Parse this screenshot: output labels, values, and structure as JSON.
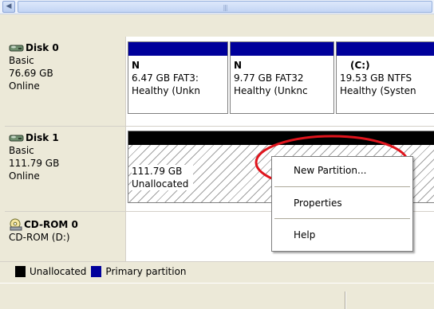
{
  "disks": [
    {
      "name": "Disk 0",
      "type": "Basic",
      "size": "76.69 GB",
      "status": "Online",
      "partitions": [
        {
          "label": "N",
          "detail": "6.47 GB FAT3:",
          "health": "Healthy (Unkn"
        },
        {
          "label": "N",
          "detail": "9.77 GB FAT32",
          "health": "Healthy (Unknc"
        },
        {
          "label": "(C:)",
          "detail": "19.53 GB NTFS",
          "health": "Healthy (Systen"
        }
      ]
    },
    {
      "name": "Disk 1",
      "type": "Basic",
      "size": "111.79 GB",
      "status": "Online",
      "unallocated": {
        "size": "111.79 GB",
        "label": "Unallocated"
      }
    }
  ],
  "cdrom": {
    "name": "CD-ROM 0",
    "drive": "CD-ROM (D:)"
  },
  "context_menu": {
    "items": [
      "New Partition...",
      "Properties",
      "Help"
    ]
  },
  "legend": {
    "items": [
      {
        "label": "Unallocated",
        "color": "#000000"
      },
      {
        "label": "Primary partition",
        "color": "#00009b"
      }
    ]
  },
  "colors": {
    "partition_bar": "#00009b",
    "unallocated_bar": "#000000",
    "annotation": "#e0141c"
  }
}
